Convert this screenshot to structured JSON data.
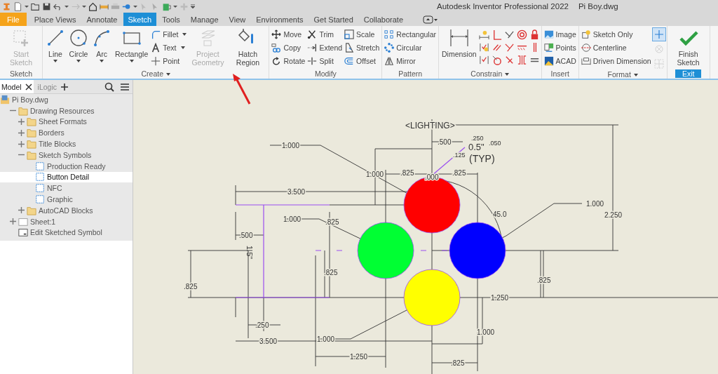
{
  "title_bar": {
    "app": "Autodesk Inventor Professional 2022",
    "document": "Pi Boy.dwg"
  },
  "tabs": [
    {
      "label": "File",
      "kind": "file",
      "selected": false
    },
    {
      "label": "Place Views",
      "kind": "tab",
      "selected": false
    },
    {
      "label": "Annotate",
      "kind": "tab",
      "selected": false
    },
    {
      "label": "Sketch",
      "kind": "tab",
      "selected": true
    },
    {
      "label": "Tools",
      "kind": "tab",
      "selected": false
    },
    {
      "label": "Manage",
      "kind": "tab",
      "selected": false
    },
    {
      "label": "View",
      "kind": "tab",
      "selected": false
    },
    {
      "label": "Environments",
      "kind": "tab",
      "selected": false
    },
    {
      "label": "Get Started",
      "kind": "tab",
      "selected": false
    },
    {
      "label": "Collaborate",
      "kind": "tab",
      "selected": false
    }
  ],
  "ribbon": {
    "panels": [
      {
        "label": "Sketch",
        "menu": false,
        "accent": false,
        "columns": [
          {
            "kind": "large",
            "label": "Start Sketch",
            "disabled": true,
            "dropdown": false
          }
        ]
      },
      {
        "label": "Create",
        "menu": true,
        "accent": false,
        "columns": [
          {
            "kind": "large",
            "label": "Line",
            "disabled": false,
            "dropdown": true
          },
          {
            "kind": "large",
            "label": "Circle",
            "disabled": false,
            "dropdown": true
          },
          {
            "kind": "large",
            "label": "Arc",
            "disabled": false,
            "dropdown": true
          },
          {
            "kind": "large",
            "label": "Rectangle",
            "disabled": false,
            "dropdown": true
          },
          {
            "kind": "stack",
            "items": [
              {
                "label": "Fillet",
                "dropdown": true
              },
              {
                "label": "Text",
                "dropdown": true
              },
              {
                "label": "Point",
                "dropdown": false
              }
            ]
          },
          {
            "kind": "large",
            "label": "Project Geometry",
            "disabled": true,
            "dropdown": false
          },
          {
            "kind": "large",
            "label": "Hatch Region",
            "disabled": false,
            "dropdown": false
          }
        ]
      },
      {
        "label": "Modify",
        "menu": false,
        "accent": false,
        "columns": [
          {
            "kind": "stack",
            "items": [
              {
                "label": "Move",
                "dropdown": false
              },
              {
                "label": "Copy",
                "dropdown": false
              },
              {
                "label": "Rotate",
                "dropdown": false
              }
            ]
          },
          {
            "kind": "stack",
            "items": [
              {
                "label": "Trim",
                "dropdown": false
              },
              {
                "label": "Extend",
                "dropdown": false
              },
              {
                "label": "Split",
                "dropdown": false
              }
            ]
          },
          {
            "kind": "stack",
            "items": [
              {
                "label": "Scale",
                "dropdown": false
              },
              {
                "label": "Stretch",
                "dropdown": false
              },
              {
                "label": "Offset",
                "dropdown": false
              }
            ]
          }
        ]
      },
      {
        "label": "Pattern",
        "menu": false,
        "accent": false,
        "columns": [
          {
            "kind": "stack",
            "items": [
              {
                "label": "Rectangular",
                "dropdown": false
              },
              {
                "label": "Circular",
                "dropdown": false
              },
              {
                "label": "Mirror",
                "dropdown": false
              }
            ]
          }
        ]
      },
      {
        "label": "Constrain",
        "menu": true,
        "accent": false,
        "columns": [
          {
            "kind": "large",
            "label": "Dimension",
            "disabled": false,
            "dropdown": false
          },
          {
            "kind": "icon_grid"
          }
        ]
      },
      {
        "label": "Insert",
        "menu": false,
        "accent": false,
        "columns": [
          {
            "kind": "stack",
            "items": [
              {
                "label": "Image",
                "dropdown": false
              },
              {
                "label": "Points",
                "dropdown": false
              },
              {
                "label": "ACAD",
                "dropdown": false
              }
            ]
          }
        ]
      },
      {
        "label": "Format",
        "menu": true,
        "accent": false,
        "columns": [
          {
            "kind": "stack",
            "items": [
              {
                "label": "Sketch Only",
                "dropdown": false
              },
              {
                "label": "Centerline",
                "dropdown": false
              },
              {
                "label": "Driven Dimension",
                "dropdown": false
              }
            ]
          },
          {
            "kind": "icon_stack",
            "icons": [
              {
                "selected": true,
                "disabled": false
              },
              {
                "selected": false,
                "disabled": true
              },
              {
                "selected": false,
                "disabled": true
              }
            ]
          }
        ]
      },
      {
        "label": "Exit",
        "menu": false,
        "accent": true,
        "columns": [
          {
            "kind": "large",
            "label": "Finish Sketch",
            "disabled": false,
            "dropdown": false
          }
        ]
      }
    ]
  },
  "browser": {
    "tabs": [
      {
        "label": "Model",
        "selected": true,
        "closable": true
      },
      {
        "label": "iLogic",
        "selected": false,
        "closable": false
      }
    ],
    "tree": [
      {
        "label": "Pi Boy.dwg",
        "kind": "document",
        "selected": false,
        "children": [
          {
            "label": "Drawing Resources",
            "kind": "folder",
            "selected": false,
            "expanded": true,
            "children": [
              {
                "label": "Sheet Formats",
                "kind": "folder",
                "selected": false,
                "expanded": false
              },
              {
                "label": "Borders",
                "kind": "folder",
                "selected": false,
                "expanded": false
              },
              {
                "label": "Title Blocks",
                "kind": "folder",
                "selected": false,
                "expanded": false
              },
              {
                "label": "Sketch Symbols",
                "kind": "folder",
                "selected": false,
                "expanded": true,
                "children": [
                  {
                    "label": "Production Ready",
                    "kind": "symbol",
                    "selected": false
                  },
                  {
                    "label": "Button Detail",
                    "kind": "symbol",
                    "selected": true
                  },
                  {
                    "label": "NFC",
                    "kind": "symbol",
                    "selected": false
                  },
                  {
                    "label": "Graphic",
                    "kind": "symbol",
                    "selected": false
                  }
                ]
              },
              {
                "label": "AutoCAD Blocks",
                "kind": "folder",
                "selected": false,
                "expanded": false
              }
            ]
          },
          {
            "label": "Sheet:1",
            "kind": "sheet",
            "selected": false,
            "expanded": false
          },
          {
            "label": "Edit Sketched Symbol",
            "kind": "edit",
            "selected": false
          }
        ]
      }
    ]
  },
  "drawing": {
    "circles": [
      {
        "color": "#ff0000"
      },
      {
        "color": "#00ff33"
      },
      {
        "color": "#0000ff"
      },
      {
        "color": "#ffff00"
      }
    ],
    "labels": [
      "<LIGHTING>",
      "1.000",
      ".500",
      ".250",
      "0.5\"",
      ".050",
      ".125",
      "(TYP)",
      "1.000",
      ".825",
      ".000",
      ".825",
      "3.500",
      "1.000",
      ".825",
      ".500",
      "1.5\"",
      "45.0",
      "1.000",
      "2.250",
      ".825",
      ".825",
      ".825",
      "1.250",
      ".250",
      "3.500",
      "1.000",
      "1.000",
      "1.250",
      ".825"
    ]
  }
}
